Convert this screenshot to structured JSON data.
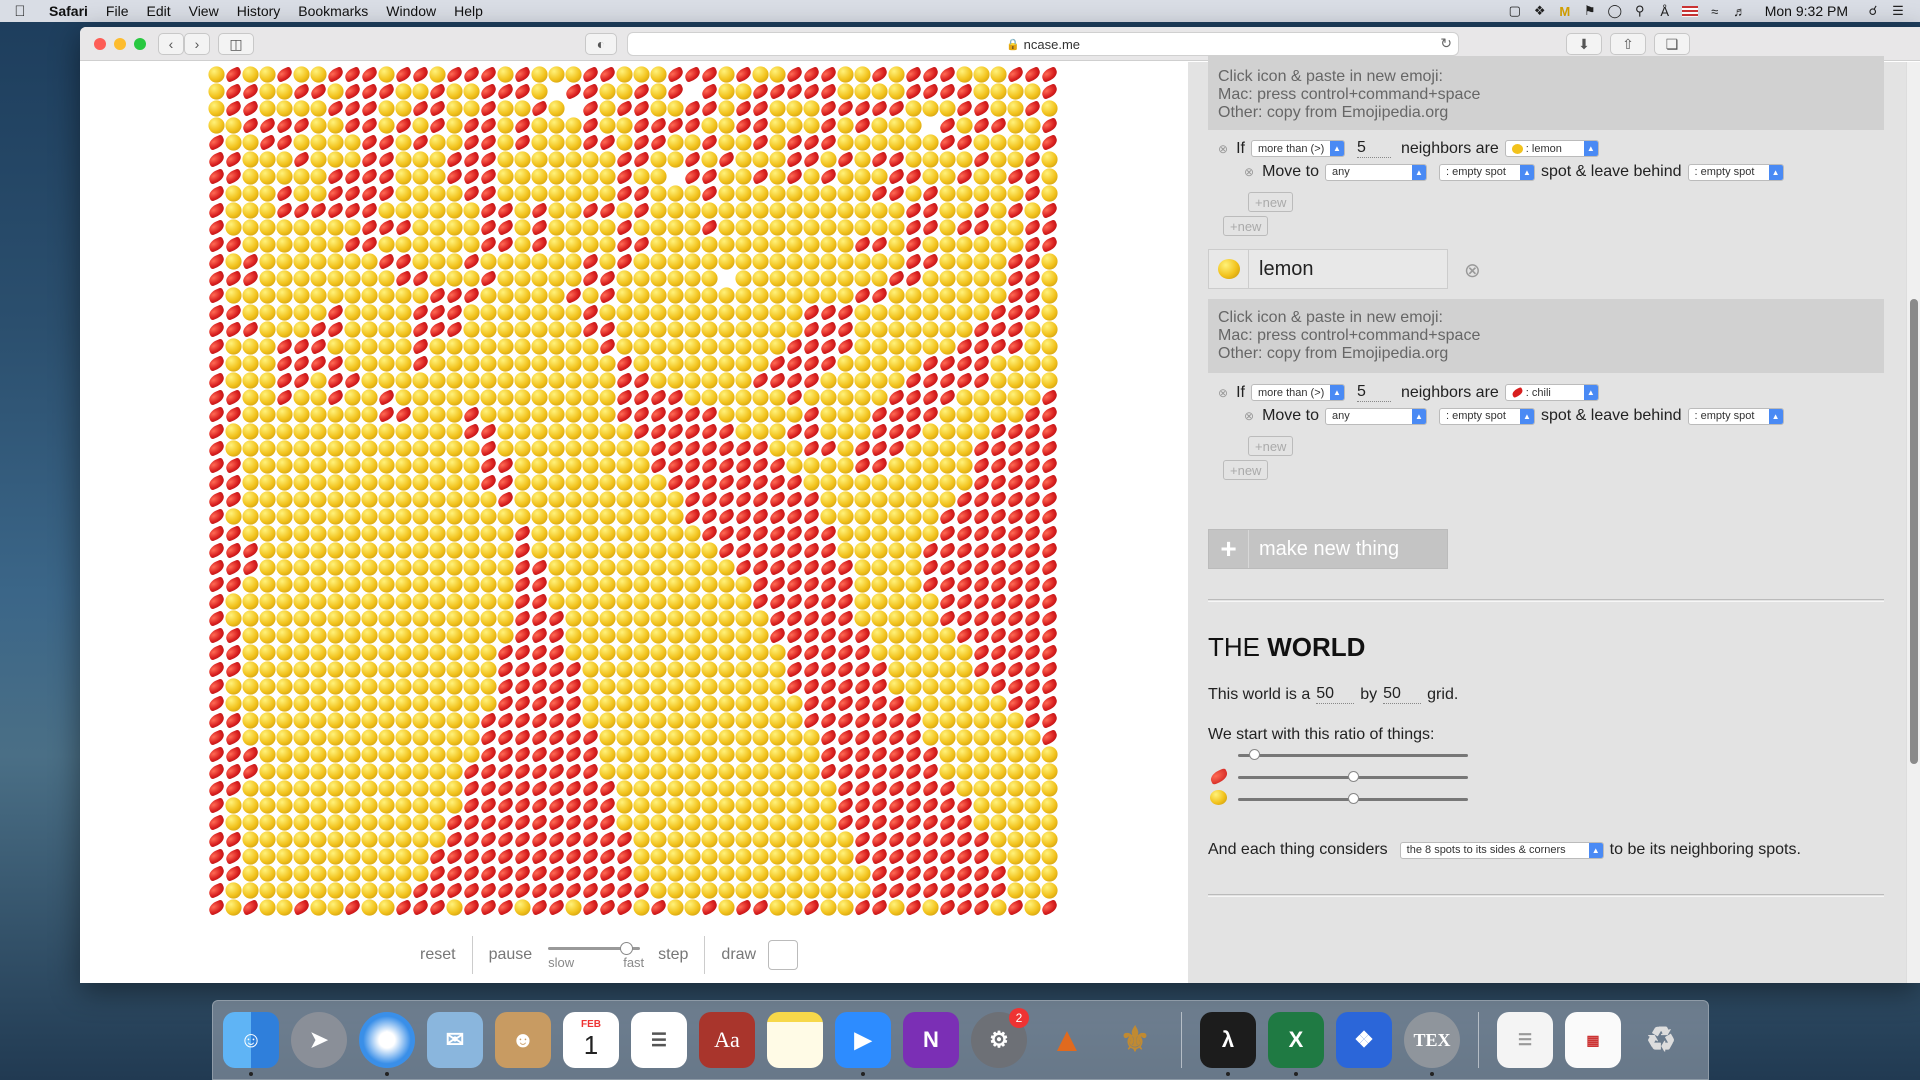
{
  "menubar": {
    "app": "Safari",
    "items": [
      "File",
      "Edit",
      "View",
      "History",
      "Bookmarks",
      "Window",
      "Help"
    ],
    "clock": "Mon 9:32 PM"
  },
  "browser": {
    "url": "ncase.me"
  },
  "controls": {
    "reset": "reset",
    "pause": "pause",
    "slow": "slow",
    "fast": "fast",
    "step": "step",
    "draw": "draw",
    "speed_level": 0.9
  },
  "panel": {
    "hint_line1": "Click icon & paste in new emoji:",
    "hint_line2": "Mac: press control+command+space",
    "hint_line3": "Other: copy from Emojipedia.org",
    "chili_rule": {
      "if": "If",
      "condition": "more than (>)",
      "count": "5",
      "neighbors_are": "neighbors are",
      "neighbor_type": ": lemon",
      "move_to": "Move to",
      "any": "any",
      "target": ": empty spot",
      "leave_behind": "spot & leave behind",
      "behind": ": empty spot",
      "new_inner": "+new",
      "new_outer": "+new"
    },
    "lemon": {
      "name": "lemon",
      "rule": {
        "if": "If",
        "condition": "more than (>)",
        "count": "5",
        "neighbors_are": "neighbors are",
        "neighbor_type": ": chili",
        "move_to": "Move to",
        "any": "any",
        "target": ": empty spot",
        "leave_behind": "spot & leave behind",
        "behind": ": empty spot",
        "new_inner": "+new",
        "new_outer": "+new"
      }
    },
    "make_new": "make new thing",
    "world": {
      "title_the": "THE",
      "title_world": "WORLD",
      "size_prefix": "This world is a",
      "width": "50",
      "by": "by",
      "height": "50",
      "grid": "grid.",
      "ratio_label": "We start with this ratio of things:",
      "ratio_empty": 0.05,
      "ratio_chili": 0.5,
      "ratio_lemon": 0.5,
      "neighbors_prefix": "And each thing considers",
      "neighbors_option": "the 8 spots to its sides & corners",
      "neighbors_suffix": "to be its neighboring spots."
    }
  },
  "grid": {
    "size": 50,
    "legend": {
      "C": "chili",
      "L": "lemon",
      "_": "empty"
    },
    "rows": [
      "LCLLCLLCCCLCCLCCCLCLLLCCLLLCCCLCLLCCCLLCLCCCLLLCCC",
      "LCCLLCCLCCCLLCLLCCCL_CCLLCLC_CLLCCCCCLLLLCCCCLLLLC",
      "LCCLLLLCCCLLCCLLCLLCL_CLCCLLCCLCCLLLCCCCCLLLCCLLCL",
      "LLCCCCLLCCLCLCLCCLCLLLCLLCCCCLLCCLLLCLCLLL_CLCCLLC",
      "CLLCCLLLLCCLCLLCCLCLLLCCLCCLLCLLCLCCCLLLLLLCCLLLLC",
      "CCLLLCLLLCCLLLCCCLLLLLLLCCLLCLCLLLCCLCLCCLLLLCLLCL",
      "CCLLLLLCCCCLLLCCCLLLLLLLCLL_CCLLCLCLCLLLCCLLCLLCCL",
      "CLLLCLLCCCCLLLLCCLLLLLLLCCLLLCLLLLLLLLLCCLCLLLLLCL",
      "CLLLCCCCCCLLLLLLCCLCLLCCLCLLLLLLLLLLLLLLLCCLLCLCLC",
      "CLLLLLLLLCCCLLLLCCLCLLLLCLLLLCLLLLLLLLLLLCCLCCLLCC",
      "CCLLLLLLCCLLLLLLCCLCLLLLCCLLLLLLLLLLLLCCLCLLLLLLCC",
      "CLCLLLLLLLCCLLLCLLLLLLCLCLLLLLLLLLLLLLLLLCCLLLLCCL",
      "CCCLLLLLLLLCCLLLCLLLLLCCLLLLLL_LLLLLLLLLCCLLLLLCCL",
      "CLLLLLLLLLLLLCCCLLLLLCLCLLLLLLLLLLLLLLCCLLLLLLLCCL",
      "CCLLLLLCLLLLCCCLLLLLLLCLLLLLLLLLLLLCCCLLLLLLLLCCCL",
      "CCCLLLCCLLLLCCCLLLLLLLCCLLLLLLLLLLLCCCLLLLLLLCCCLL",
      "CLLLCCCLLLLLCLLLLLLLLLLCLLLLLLLLLLCCCCLLLLLLCCCCLL",
      "CLLLCCCCLLLLCLLLLLLLLLLLCLLLLLLLLCCCCLLLLLCCCCLLLL",
      "CLLLCCLCCLLLLLLLLLLLLLLLCCLLLLLLCCCCLLLLLCCCCCLLLL",
      "CCLLCLLCLLCLLLLLLLLLLLLLCCCCLLLLLLCLLLLLCCCCLLLLLC",
      "CCLLLLLLLLCCLLLCLLLLLLLLCCCCCCLLLLLCLLLCCCCLLLLLCC",
      "CLLLLLLLLLLLLLLCCLLLLLLLLCCCCCCLLLCCLLLCCCLLLLCCCC",
      "CLLLLLLLLLLLLLLLCLLLLLLLLLCCCCCCCLLCCLCCCLLLLCCCCC",
      "CCLLLLLLLLLLLLLLCCLLLLLLLLCCCCCCCCLLLLCCLLLLLCCCCC",
      "CCLLLLLLLLLLLLLLCCLLLLLLLLLCCCCCCCCLLLLLLLLLLCCCCC",
      "CCLLLLLLLLLLLLLLLCLLLLLLLLLLCCCCCCCCLLLLLLLLCCCCCC",
      "CLLLLLLLLLLLLLLLLLLLLLLLLLLLCCCCCCCCLLLLLLLCCCCCCC",
      "CCLLLLLLLLLLLLLLLLCLLLLLLLLLLCCCCCCCCLLLLLLCCCCCCC",
      "CCCLLLLLLLLLLLLLLLCLLLLLLLLLLLCCCCCCCLLLLLCCCCCCCC",
      "CCCLLLLLLLLLLLLLLLCCLLLLLLLLLLLCCCCCCCLLLLCCCCCCCC",
      "CCLLLLLLLLLLLLLLLLCCLLLLLLLLLLLLCCCCCCLLLLCCCCCCCC",
      "CLLLLLLLLLLLLLLLLLCCLLLLLLLLLLLLCCCCCCLLLLLCCCCCCC",
      "CLLLLLLLLLLLLLLLLLCCCLLLLLLLLLLLLCCCCCLLLLLCCCCCCC",
      "CCLLLLLLLLLLLLLLLLCCCLLLLLLLLLLLLCCCCCCLLLLLCCCCCC",
      "CCLLLLLLLLLLLLLLLCCCCLLLLLLLLLLLLLCCCCCLLLLLLCCCCC",
      "CCLLLLLLLLLLLLLLLCCCCCLLLLLLLLLLLLCCCCCCLLLLLCCCCC",
      "CLLLLLLLLLLLLLLLLCCCCCLLLLLLLLLLLLCCCCCCLLLLLLCCCC",
      "CLLLLLLLLLLLLLLLLCCCCCLLLLLLLLLLLLLCCCCCCLLLLLLCCC",
      "CCLLLLLLLLLLLLLLCCCCCCLLLLLLLLLLLLLCCCCCCCLLLLLLCC",
      "CCLLLLLLLLLLLLLLCCCCCCCLLLLLLLLLLLLLCCCCCCLLLLLLLC",
      "CCCLLLLLLLLLLLLLCCCCCCCLLLLLLLLLLLLLCCCCCCCLLLLLLL",
      "CCCLLLLLLLLLLLLCCCCCCCCLLLLLLLLLLLLLCCCCCCCLLLLLLL",
      "CCLLLLLLLLLLLLLCCCCCCCCCLLLLLLLLLLLLLCCCCCCCLLLLLL",
      "CLLLLLLLLLLLLLLCCCCCCCCCLLLLLLLLLLLLLCCCCCCCCLLLLL",
      "CLLLLLLLLLLLLLCCCCCCCCCCLLLLLLLLLLLLLCCCCCCCCLLLLL",
      "CCLLLLLLLLLLLLCCCCCCCCCCCLLLLLLLLLLLLLCCCCCCCCLLLL",
      "CCLLLLLLLLLLLCCCCCCCCCCCCLLLLLLLLLLLLLCCCCCCCCLLLL",
      "CCLLLLLLLLLLLCCCCCCCCCCCCLLLLLLLLLLLLLLCCCCCCCCLLL",
      "CLLLLLLLLLLLCCCCCCCCCCCCCCLLLLLLLLLLLLLCCCCCCCCLLL",
      "CLCLLCLLCLLCCCLCCCLCCLCCCLCLLCLCCLLCLLCCLCLCCCLCLC"
    ]
  },
  "dock": {
    "apps": [
      "Finder",
      "Launchpad",
      "Safari",
      "Mail",
      "Contacts",
      "Calendar",
      "Reminders",
      "Dictionary",
      "Notes",
      "Zoom",
      "OneNote",
      "System Preferences",
      "MATLAB",
      "Microscope",
      "Acrobat",
      "Excel",
      "Dropbox",
      "TeX",
      "Preview",
      "Document",
      "Trash"
    ],
    "calendar_month": "FEB",
    "calendar_day": "1",
    "sysprefs_badge": "2",
    "dictionary_label": "Aa",
    "tex_label": "TEX"
  }
}
